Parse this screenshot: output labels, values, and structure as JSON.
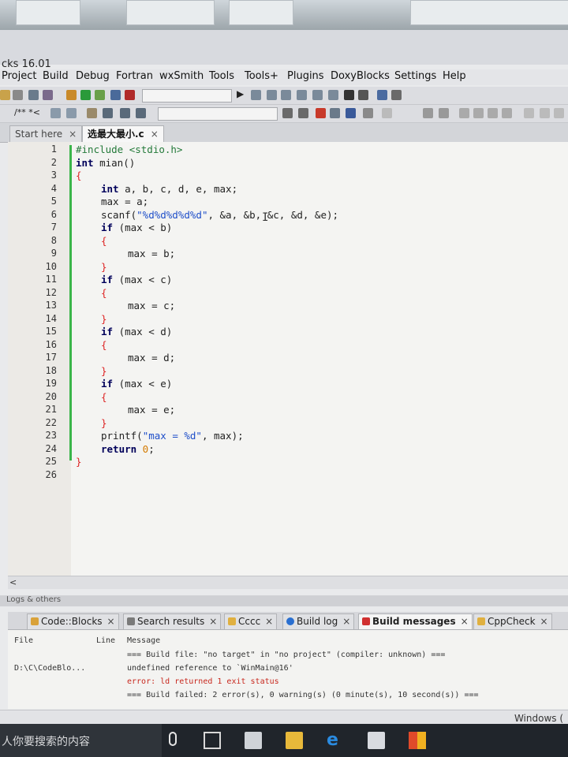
{
  "app": {
    "title": "cks 16.01"
  },
  "menu": [
    "Project",
    "Build",
    "Debug",
    "Fortran",
    "wxSmith",
    "Tools",
    "Tools+",
    "Plugins",
    "DoxyBlocks",
    "Settings",
    "Help"
  ],
  "toolbar2": {
    "comment_label": "/** *<"
  },
  "tabs": [
    {
      "label": "Start here",
      "close": "×"
    },
    {
      "label": "选最大最小.c",
      "close": "×"
    }
  ],
  "line_numbers": [
    "1",
    "2",
    "3",
    "4",
    "5",
    "6",
    "7",
    "8",
    "9",
    "10",
    "11",
    "12",
    "13",
    "14",
    "15",
    "16",
    "17",
    "18",
    "19",
    "20",
    "21",
    "22",
    "23",
    "24",
    "25",
    "26"
  ],
  "code": {
    "l1": "#include <stdio.h>",
    "l2_kw": "int",
    "l2_rest": " mian()",
    "l3": "{",
    "l4_kw": "int",
    "l4_rest": " a, b, c, d, e, max;",
    "l5": "max = a;",
    "l6_a": "scanf(",
    "l6_str": "\"%d%d%d%d%d\"",
    "l6_b": ", &a, &b, &c, &d, &e);",
    "if": "if",
    "l7_rest": " (max < b)",
    "open": "{",
    "close": "}",
    "l9": "max = b;",
    "l11_rest": " (max < c)",
    "l13": "max = c;",
    "l15_rest": " (max < d)",
    "l17": "max = d;",
    "l19_rest": " (max < e)",
    "l21": "max = e;",
    "l23_a": "printf(",
    "l23_str": "\"max = %d\"",
    "l23_b": ", max);",
    "l24_kw": "return",
    "l24_num": " 0",
    "l24_b": ";",
    "l25": "}"
  },
  "logs": {
    "title": "Logs & others",
    "tabs": [
      {
        "label": "Code::Blocks",
        "close": "×",
        "icon_color": "#d9a23a"
      },
      {
        "label": "Search results",
        "close": "×",
        "icon_color": "#7a7a7a"
      },
      {
        "label": "Cccc",
        "close": "×",
        "icon_color": "#e0b040"
      },
      {
        "label": "Build log",
        "close": "×",
        "icon_color": "#2a6fd0"
      },
      {
        "label": "Build messages",
        "close": "×",
        "icon_color": "#d03030"
      },
      {
        "label": "CppCheck",
        "close": "×",
        "icon_color": "#e0b040"
      }
    ],
    "columns": [
      "File",
      "Line",
      "Message"
    ],
    "rows": [
      {
        "file": "",
        "line": "",
        "message": "=== Build file: \"no target\" in \"no project\" (compiler: unknown) ===",
        "error": false
      },
      {
        "file": "D:\\C\\CodeBlo...",
        "line": "",
        "message": "undefined reference to `WinMain@16'",
        "error": false
      },
      {
        "file": "",
        "line": "",
        "message": "error: ld returned 1 exit status",
        "error": true
      },
      {
        "file": "",
        "line": "",
        "message": "=== Build failed: 2 error(s), 0 warning(s) (0 minute(s), 10 second(s)) ===",
        "error": false
      }
    ]
  },
  "status": {
    "right": "Windows ("
  },
  "taskbar": {
    "search_placeholder": "人你要搜索的内容"
  }
}
